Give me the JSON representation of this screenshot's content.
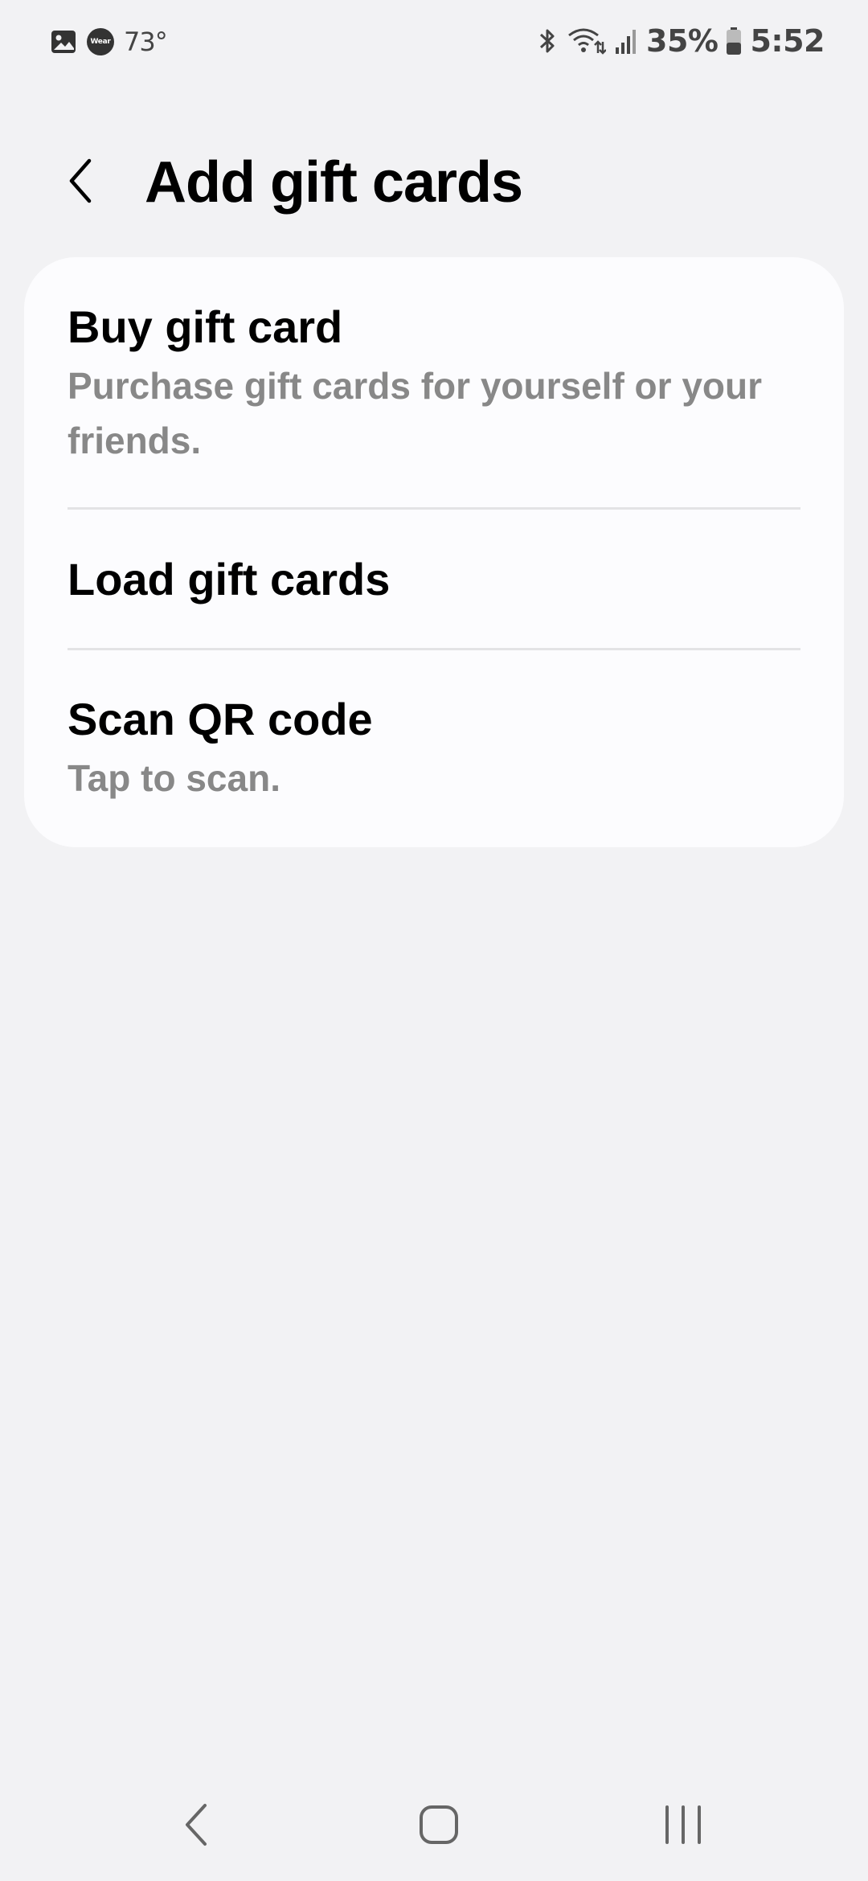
{
  "status_bar": {
    "icons_left": [
      "gallery-icon",
      "wear-icon"
    ],
    "wear_badge": "Wear",
    "temperature": "73°",
    "icons_right": [
      "bluetooth-icon",
      "wifi-icon",
      "signal-icon",
      "battery-icon"
    ],
    "battery_percent": "35%",
    "time": "5:52"
  },
  "header": {
    "title": "Add gift cards"
  },
  "menu": {
    "items": [
      {
        "title": "Buy gift card",
        "subtitle": "Purchase gift cards for yourself or your friends."
      },
      {
        "title": "Load gift cards"
      },
      {
        "title": "Scan QR code",
        "subtitle": "Tap to scan."
      }
    ]
  },
  "nav_bar": {
    "buttons": [
      "back-nav-icon",
      "home-nav-icon",
      "recents-nav-icon"
    ]
  },
  "colors": {
    "background": "#f2f2f4",
    "card": "#fcfcfe",
    "title": "#000000",
    "subtitle": "#888888",
    "divider": "#e3e3e5"
  }
}
